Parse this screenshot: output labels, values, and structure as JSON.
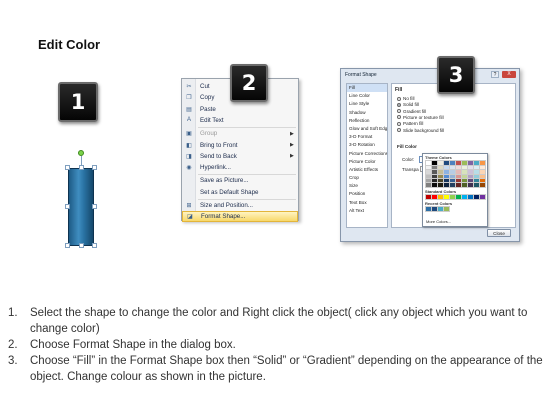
{
  "title": "Edit Color",
  "badges": [
    "1",
    "2",
    "3"
  ],
  "context_menu": {
    "items": [
      {
        "label": "Cut",
        "icon": "scissors-icon",
        "glyph": "✂",
        "submenu": false,
        "disabled": false
      },
      {
        "label": "Copy",
        "icon": "copy-icon",
        "glyph": "❐",
        "submenu": false,
        "disabled": false
      },
      {
        "label": "Paste",
        "icon": "paste-icon",
        "glyph": "▤",
        "submenu": false,
        "disabled": false
      },
      {
        "label": "Edit Text",
        "icon": "edit-text-icon",
        "glyph": "A",
        "submenu": false,
        "disabled": false
      },
      {
        "label": "Group",
        "icon": "group-icon",
        "glyph": "▣",
        "submenu": true,
        "disabled": true
      },
      {
        "label": "Bring to Front",
        "icon": "bring-to-front-icon",
        "glyph": "◧",
        "submenu": true,
        "disabled": false
      },
      {
        "label": "Send to Back",
        "icon": "send-to-back-icon",
        "glyph": "◨",
        "submenu": true,
        "disabled": false
      },
      {
        "label": "Hyperlink...",
        "icon": "hyperlink-icon",
        "glyph": "◉",
        "submenu": false,
        "disabled": false
      },
      {
        "label": "Save as Picture...",
        "icon": "",
        "glyph": "",
        "submenu": false,
        "disabled": false
      },
      {
        "label": "Set as Default Shape",
        "icon": "",
        "glyph": "",
        "submenu": false,
        "disabled": false
      },
      {
        "label": "Size and Position...",
        "icon": "size-icon",
        "glyph": "⊞",
        "submenu": false,
        "disabled": false
      },
      {
        "label": "Format Shape...",
        "icon": "format-shape-icon",
        "glyph": "◪",
        "submenu": false,
        "disabled": false,
        "highlighted": true
      }
    ]
  },
  "dialog": {
    "title": "Format Shape",
    "close_glyph": "X",
    "help_glyph": "?",
    "nav": [
      "Fill",
      "Line Color",
      "Line Style",
      "Shadow",
      "Reflection",
      "Glow and Soft Edges",
      "3-D Format",
      "3-D Rotation",
      "Picture Corrections",
      "Picture Color",
      "Artistic Effects",
      "Crop",
      "Size",
      "Position",
      "Text Box",
      "Alt Text"
    ],
    "fill_heading": "Fill",
    "fill_options": [
      "No fill",
      "Solid fill",
      "Gradient fill",
      "Picture or texture fill",
      "Pattern fill",
      "Slide background fill"
    ],
    "fill_color_heading": "Fill Color",
    "color_label": "Color:",
    "transparency_label": "Transpa",
    "close_button": "Close",
    "palette": {
      "theme_label": "Theme Colors",
      "standard_label": "Standard Colors",
      "recent_label": "Recent Colors",
      "more_label": "More Colors...",
      "theme_row": [
        "#ffffff",
        "#000000",
        "#eeece1",
        "#1f497d",
        "#4f81bd",
        "#c0504d",
        "#9bbb59",
        "#8064a2",
        "#4bacc6",
        "#f79646"
      ],
      "theme_shades": [
        [
          "#f2f2f2",
          "#7f7f7f",
          "#ddd9c3",
          "#c6d9f0",
          "#dbe5f1",
          "#f2dcdb",
          "#ebf1dd",
          "#e5e0ec",
          "#dbeef3",
          "#fdeada"
        ],
        [
          "#d8d8d8",
          "#595959",
          "#c4bd97",
          "#8db3e2",
          "#b8cce4",
          "#e5b9b7",
          "#d7e3bc",
          "#ccc1d9",
          "#b7dde8",
          "#fbd5b5"
        ],
        [
          "#bfbfbf",
          "#3f3f3f",
          "#938953",
          "#548dd4",
          "#95b3d7",
          "#d99694",
          "#c3d69b",
          "#b2a2c7",
          "#92cddc",
          "#fac08f"
        ],
        [
          "#a5a5a5",
          "#262626",
          "#494429",
          "#17365d",
          "#366092",
          "#953734",
          "#76923c",
          "#5f497a",
          "#31859b",
          "#e36c09"
        ],
        [
          "#7f7f7f",
          "#0c0c0c",
          "#1d1b10",
          "#0f243e",
          "#244061",
          "#632423",
          "#4f6128",
          "#3f3151",
          "#205867",
          "#974806"
        ]
      ],
      "standard_row": [
        "#c00000",
        "#ff0000",
        "#ffc000",
        "#ffff00",
        "#92d050",
        "#00b050",
        "#00b0f0",
        "#0070c0",
        "#002060",
        "#7030a0"
      ],
      "recent_row": [
        "#2b6ea6",
        "#1f497d",
        "#4bacc6",
        "#9bbb59"
      ]
    }
  },
  "instructions": [
    {
      "num": "1.",
      "text": "Select the shape to change the color and Right click the object( click any object which you want to change color)"
    },
    {
      "num": "2.",
      "text": "Choose Format Shape in the dialog box."
    },
    {
      "num": "3.",
      "text": "Choose “Fill” in the Format Shape box then “Solid” or “Gradient” depending on the appearance of the object. Change colour as shown in the picture."
    }
  ]
}
